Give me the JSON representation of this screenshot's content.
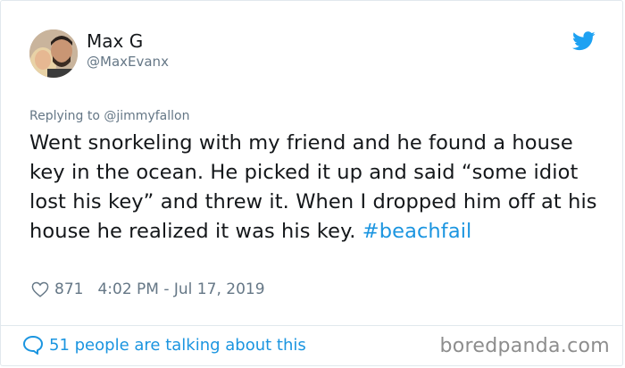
{
  "user": {
    "display_name": "Max G",
    "handle": "@MaxEvanx"
  },
  "reply": {
    "prefix": "Replying to ",
    "mention": "@jimmyfallon"
  },
  "tweet": {
    "text": "Went snorkeling with my friend and he found a house key in the ocean. He picked it up and said “some idiot lost his key” and threw it. When I dropped him off at his house he realized it was his key. ",
    "hashtag": "#beachfail"
  },
  "meta": {
    "like_count": "871",
    "timestamp": "4:02 PM - Jul 17, 2019"
  },
  "footer": {
    "talking_label": "51 people are talking about this",
    "watermark": "boredpanda.com"
  },
  "icons": {
    "brand": "twitter-bird-icon",
    "like": "heart-icon",
    "reply": "speech-bubble-icon"
  },
  "colors": {
    "accent": "#1b95e0",
    "secondary_text": "#657786",
    "primary_text": "#14171a",
    "border": "#e1e8ed"
  }
}
